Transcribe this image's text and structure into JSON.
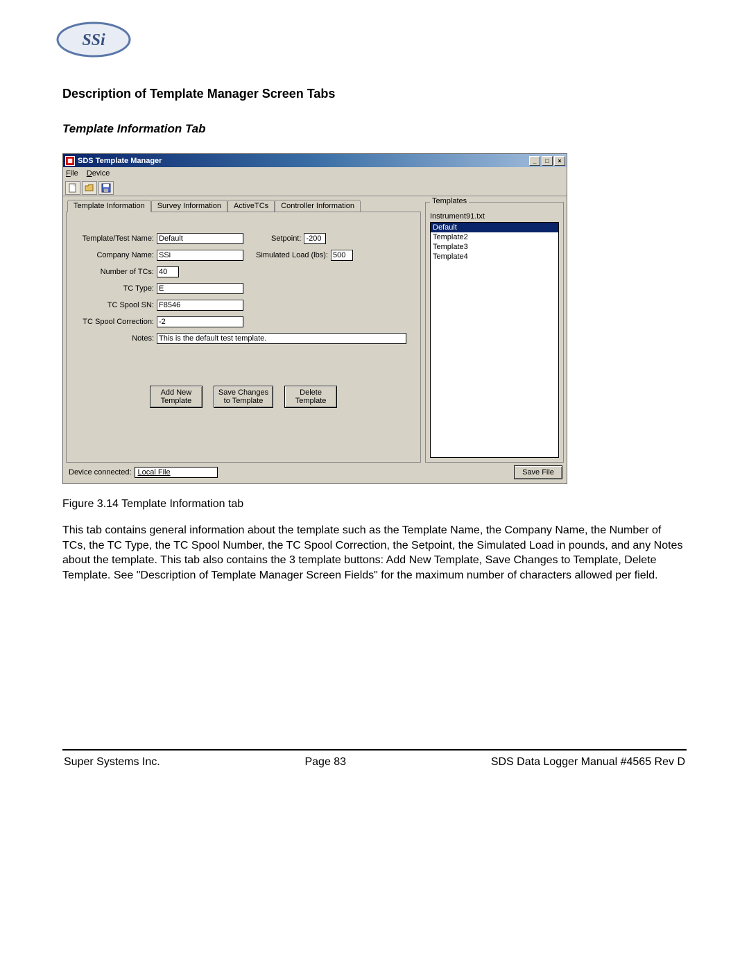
{
  "doc": {
    "heading": "Description of Template Manager Screen Tabs",
    "subheading": "Template Information Tab",
    "caption": "Figure 3.14 Template Information tab",
    "paragraph": "This tab contains general information about the template such as the Template Name, the Company Name, the Number of TCs, the TC Type, the TC Spool Number, the TC Spool Correction, the Setpoint, the Simulated Load in pounds, and any Notes about the template.  This tab also contains the 3 template buttons: Add New Template, Save Changes to Template, Delete Template.  See \"Description of Template Manager Screen Fields\" for the maximum number of characters allowed per field.",
    "footer_left": "Super Systems Inc.",
    "footer_center": "Page 83",
    "footer_right": "SDS Data Logger Manual #4565 Rev D"
  },
  "win": {
    "title": "SDS Template Manager",
    "menus": {
      "file": "File",
      "device": "Device"
    },
    "tabs": {
      "t1": "Template Information",
      "t2": "Survey Information",
      "t3": "ActiveTCs",
      "t4": "Controller Information"
    },
    "form": {
      "template_name_label": "Template/Test Name:",
      "template_name": "Default",
      "setpoint_label": "Setpoint:",
      "setpoint": "-200",
      "company_label": "Company Name:",
      "company": "SSi",
      "simload_label": "Simulated Load (lbs):",
      "simload": "500",
      "numtcs_label": "Number of TCs:",
      "numtcs": "40",
      "tctype_label": "TC Type:",
      "tctype": "E",
      "spoolsn_label": "TC Spool SN:",
      "spoolsn": "F8546",
      "spoolcorr_label": "TC Spool Correction:",
      "spoolcorr": "-2",
      "notes_label": "Notes:",
      "notes": "This is the default test template."
    },
    "buttons": {
      "addnew": "Add New\nTemplate",
      "savechg": "Save Changes\nto Template",
      "delete": "Delete\nTemplate",
      "savefile": "Save File"
    },
    "templates": {
      "group_title": "Templates",
      "file": "Instrument91.txt",
      "items": [
        "Default",
        "Template2",
        "Template3",
        "Template4"
      ],
      "selected_index": 0
    },
    "status": {
      "label": "Device connected:",
      "value": "Local File"
    }
  }
}
